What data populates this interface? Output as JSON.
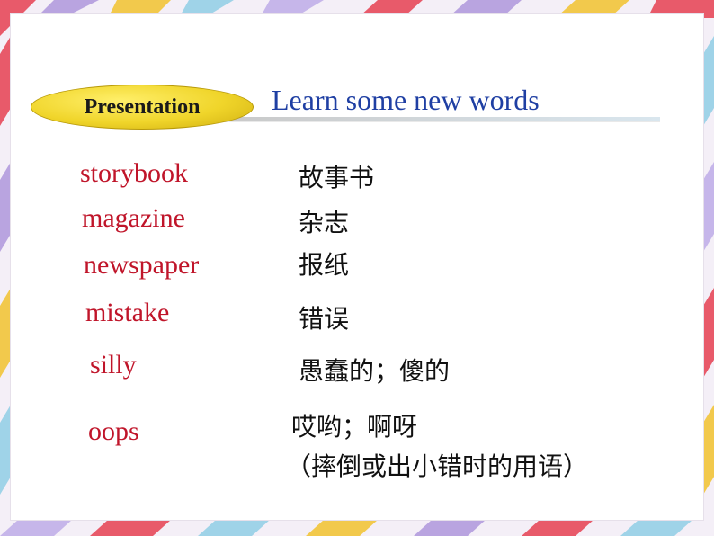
{
  "section_label": "Presentation",
  "title": "Learn some new words",
  "words": [
    {
      "en": "storybook",
      "cn": "故事书"
    },
    {
      "en": "magazine",
      "cn": "杂志"
    },
    {
      "en": "newspaper",
      "cn": "报纸"
    },
    {
      "en": "mistake",
      "cn": "错误"
    },
    {
      "en": "silly",
      "cn": "愚蠢的；傻的"
    },
    {
      "en": "oops",
      "cn": "哎哟；啊呀",
      "cn_note": "（摔倒或出小错时的用语）"
    }
  ],
  "colors": {
    "english_word": "#c0152a",
    "title": "#1f3fa3",
    "pill": "#f0d52a"
  }
}
